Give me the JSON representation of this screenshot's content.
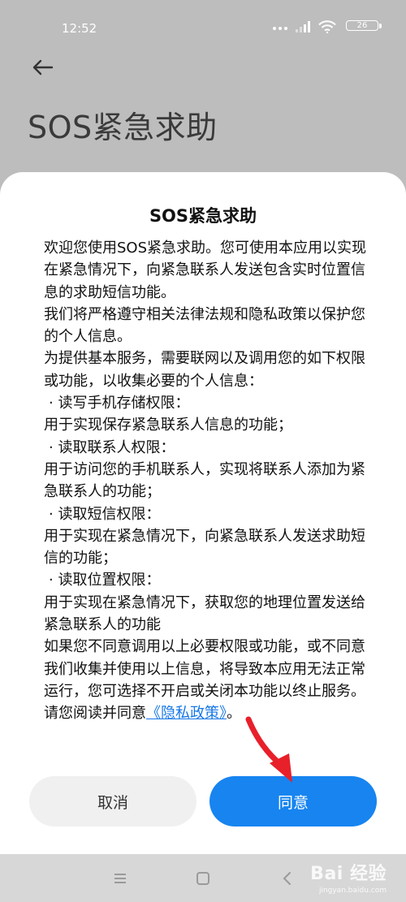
{
  "status_bar": {
    "time": "12:52",
    "battery": "26",
    "icons": [
      "signal-dots-icon",
      "signal-bars-icon",
      "wifi-icon",
      "battery-icon"
    ]
  },
  "header": {
    "back_icon": "arrow-left-icon",
    "title": "SOS紧急求助"
  },
  "dialog": {
    "title": "SOS紧急求助",
    "paragraphs": [
      "欢迎您使用SOS紧急求助。您可使用本应用以实现在紧急情况下，向紧急联系人发送包含实时位置信息的求助短信功能。",
      "我们将严格遵守相关法律法规和隐私政策以保护您的个人信息。",
      "为提供基本服务，需要联网以及调用您的如下权限或功能，以收集必要的个人信息：",
      "· 读写手机存储权限：",
      "用于实现保存紧急联系人信息的功能；",
      "· 读取联系人权限：",
      "用于访问您的手机联系人，实现将联系人添加为紧急联系人的功能；",
      "· 读取短信权限：",
      "用于实现在紧急情况下，向紧急联系人发送求助短信的功能；",
      "· 读取位置权限：",
      "用于实现在紧急情况下，获取您的地理位置发送给紧急联系人的功能",
      "如果您不同意调用以上必要权限或功能，或不同意我们收集并使用以上信息，将导致本应用无法正常运行，您可选择不开启或关闭本功能以终止服务。"
    ],
    "last_line_prefix": "请您阅读并同意",
    "privacy_link": "《隐私政策》",
    "last_line_suffix": "。",
    "cancel_label": "取消",
    "agree_label": "同意"
  },
  "nav_bar": {
    "icons": [
      "menu-icon",
      "home-icon",
      "back-icon"
    ]
  },
  "watermark": {
    "logo": "Bai 经验",
    "sub": "jingyan.baidu.com"
  },
  "colors": {
    "accent": "#1784f0",
    "link": "#1677e6",
    "annotation_arrow": "#e8202a",
    "backdrop": "#bdbdbd"
  }
}
